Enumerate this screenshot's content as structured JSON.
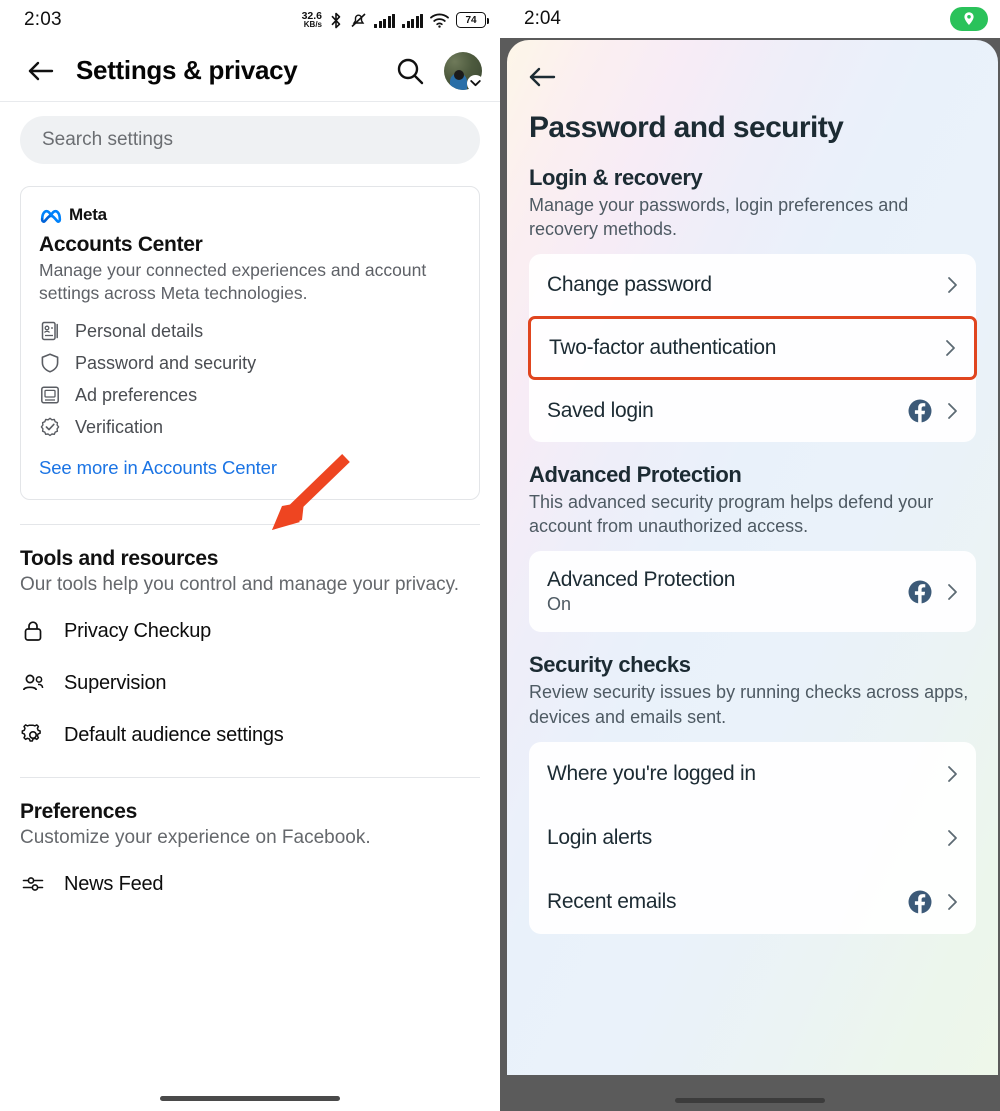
{
  "left": {
    "status": {
      "clock": "2:03",
      "net_speed_value": "32.6",
      "net_speed_unit": "KB/s",
      "battery_level": "74",
      "icons": [
        "bluetooth-icon",
        "vibrate-off-icon",
        "signal-icon",
        "signal-icon",
        "wifi-icon",
        "battery-icon"
      ]
    },
    "appbar": {
      "back_icon": "back-arrow-icon",
      "title": "Settings & privacy",
      "search_icon": "search-icon",
      "avatar": "avatar"
    },
    "search": {
      "placeholder": "Search settings"
    },
    "accounts_center": {
      "brand": "Meta",
      "title": "Accounts Center",
      "description": "Manage your connected experiences and account settings across Meta technologies.",
      "items": [
        {
          "label": "Personal details",
          "icon": "id-card-icon"
        },
        {
          "label": "Password and security",
          "icon": "shield-icon"
        },
        {
          "label": "Ad preferences",
          "icon": "monitor-icon"
        },
        {
          "label": "Verification",
          "icon": "verified-badge-icon"
        }
      ],
      "link": "See more in Accounts Center"
    },
    "tools": {
      "title": "Tools and resources",
      "subtitle": "Our tools help you control and manage your privacy.",
      "items": [
        {
          "label": "Privacy Checkup",
          "icon": "lock-icon"
        },
        {
          "label": "Supervision",
          "icon": "people-icon"
        },
        {
          "label": "Default audience settings",
          "icon": "gear-icon"
        }
      ]
    },
    "preferences": {
      "title": "Preferences",
      "subtitle": "Customize your experience on Facebook.",
      "items": [
        {
          "label": "News Feed",
          "icon": "sliders-icon"
        }
      ]
    }
  },
  "right": {
    "status": {
      "clock": "2:04",
      "location_badge_icon": "location-pin-icon"
    },
    "back_icon": "back-arrow-icon",
    "title": "Password and security",
    "sections": [
      {
        "title": "Login & recovery",
        "subtitle": "Manage your passwords, login preferences and recovery methods.",
        "rows": [
          {
            "label": "Change password",
            "sub": "",
            "fb_badge": false,
            "chevron": true,
            "highlighted": false
          },
          {
            "label": "Two-factor authentication",
            "sub": "",
            "fb_badge": false,
            "chevron": true,
            "highlighted": true
          },
          {
            "label": "Saved login",
            "sub": "",
            "fb_badge": true,
            "chevron": true,
            "highlighted": false
          }
        ]
      },
      {
        "title": "Advanced Protection",
        "subtitle": "This advanced security program helps defend your account from unauthorized access.",
        "rows": [
          {
            "label": "Advanced Protection",
            "sub": "On",
            "fb_badge": true,
            "chevron": true,
            "highlighted": false
          }
        ]
      },
      {
        "title": "Security checks",
        "subtitle": "Review security issues by running checks across apps, devices and emails sent.",
        "rows": [
          {
            "label": "Where you're logged in",
            "sub": "",
            "fb_badge": false,
            "chevron": true,
            "highlighted": false
          },
          {
            "label": "Login alerts",
            "sub": "",
            "fb_badge": false,
            "chevron": true,
            "highlighted": false
          },
          {
            "label": "Recent emails",
            "sub": "",
            "fb_badge": true,
            "chevron": true,
            "highlighted": false
          }
        ]
      }
    ]
  },
  "annotations": {
    "arrow_color": "#ee4521",
    "highlight_box_color": "#e0451f"
  },
  "colors": {
    "link_blue": "#1b74e4",
    "meta_blue": "#0082fb",
    "fb_badge": "#3c5a78",
    "green_badge": "#2ac25a"
  }
}
